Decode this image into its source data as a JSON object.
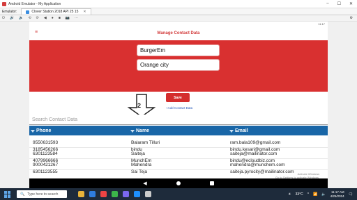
{
  "window": {
    "title": "Android Emulator - My Application"
  },
  "tabs": {
    "emulator_label": "Emulator:",
    "device_tab": "Clover Station 2018 API 25 15"
  },
  "device_status": {
    "time": "11:17"
  },
  "app": {
    "title": "Manage Contact Data"
  },
  "form": {
    "name_value": "BurgerEm",
    "city_value": "Orange city",
    "save_label": "Save",
    "add_link": "+Add Contact Data"
  },
  "search": {
    "placeholder": "Search Contact Data"
  },
  "annotation": {
    "number": "2"
  },
  "table": {
    "headers": [
      "Phone",
      "Name",
      "Email"
    ],
    "rows": [
      {
        "phone": "9550631593",
        "name": "Balaram Tilluri",
        "email": "ram.bala109@gmail.com"
      },
      {
        "phone": "6301123584",
        "name": "Saiteja",
        "email": "saiteja@mailinator.com"
      },
      {
        "phone": "9000421267",
        "name": "Mahendra",
        "email": "mahendra@munchem.com"
      },
      {
        "phone": "3185456266",
        "name": "bindu",
        "email": "bindu.kesari@gmail.com"
      },
      {
        "phone": "4079966666",
        "name": "MunchEm",
        "email": "bindu@ecloudbiz.com"
      },
      {
        "phone": "6301123555",
        "name": "Sai Teja",
        "email": "saiteja.pyrocity@mailinator.com"
      }
    ]
  },
  "watermark": {
    "line1": "Activate Windows",
    "line2": "Go to Settings to activate Windows."
  },
  "taskbar": {
    "search_placeholder": "Type here to search",
    "weather": "33°C",
    "clock_time": "11:17 AM",
    "clock_date": "4/25/2024"
  },
  "colors": {
    "red_panel": "#d93030",
    "table_header": "#1966a7",
    "taskbar": "#1e2b3b"
  }
}
